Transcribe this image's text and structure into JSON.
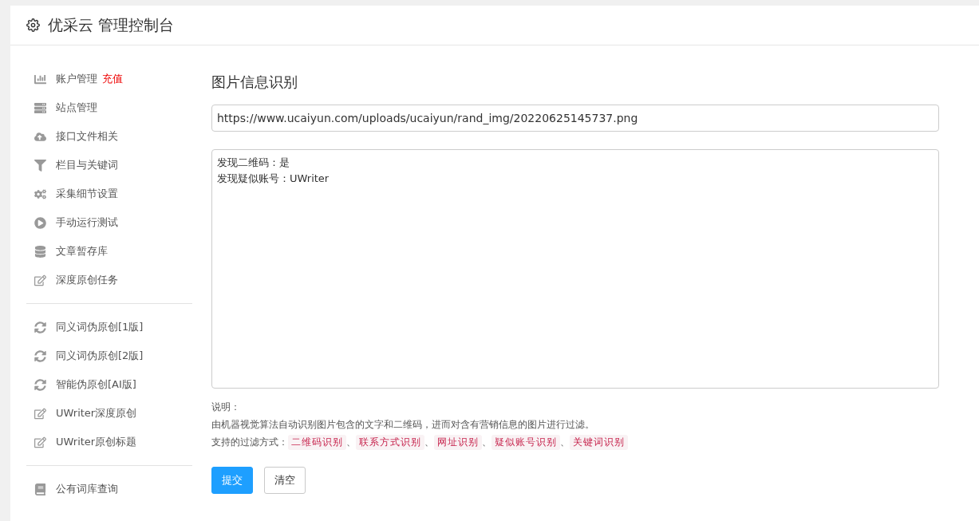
{
  "header": {
    "title": "优采云 管理控制台"
  },
  "sidebar": {
    "groups": [
      {
        "items": [
          {
            "kind": "chart",
            "label": "账户管理",
            "badge": "充值"
          },
          {
            "kind": "server",
            "label": "站点管理"
          },
          {
            "kind": "cloud",
            "label": "接口文件相关"
          },
          {
            "kind": "filter",
            "label": "栏目与关键词"
          },
          {
            "kind": "cogs",
            "label": "采集细节设置"
          },
          {
            "kind": "play",
            "label": "手动运行测试"
          },
          {
            "kind": "database",
            "label": "文章暂存库"
          },
          {
            "kind": "edit",
            "label": "深度原创任务"
          }
        ]
      },
      {
        "items": [
          {
            "kind": "sync",
            "label": "同义词伪原创[1版]"
          },
          {
            "kind": "sync",
            "label": "同义词伪原创[2版]"
          },
          {
            "kind": "sync",
            "label": "智能伪原创[AI版]"
          },
          {
            "kind": "edit",
            "label": "UWriter深度原创"
          },
          {
            "kind": "edit",
            "label": "UWriter原创标题"
          }
        ]
      },
      {
        "items": [
          {
            "kind": "book",
            "label": "公有词库查询"
          }
        ]
      }
    ]
  },
  "main": {
    "title": "图片信息识别",
    "url_field": {
      "value": "https://www.ucaiyun.com/uploads/ucaiyun/rand_img/20220625145737.png"
    },
    "result_box": {
      "lines": [
        "发现二维码：是",
        "发现疑似账号：UWriter"
      ]
    },
    "notes": {
      "heading": "说明：",
      "description": "由机器视觉算法自动识别图片包含的文字和二维码，进而对含有营销信息的图片进行过滤。",
      "methods_label": "支持的过滤方式：",
      "separator": "、",
      "methods": [
        "二维码识别",
        "联系方式识别",
        "网址识别",
        "疑似账号识别",
        "关键词识别"
      ]
    },
    "buttons": [
      {
        "kind": "primary",
        "label": "提交"
      },
      {
        "kind": "default",
        "label": "清空"
      }
    ]
  }
}
